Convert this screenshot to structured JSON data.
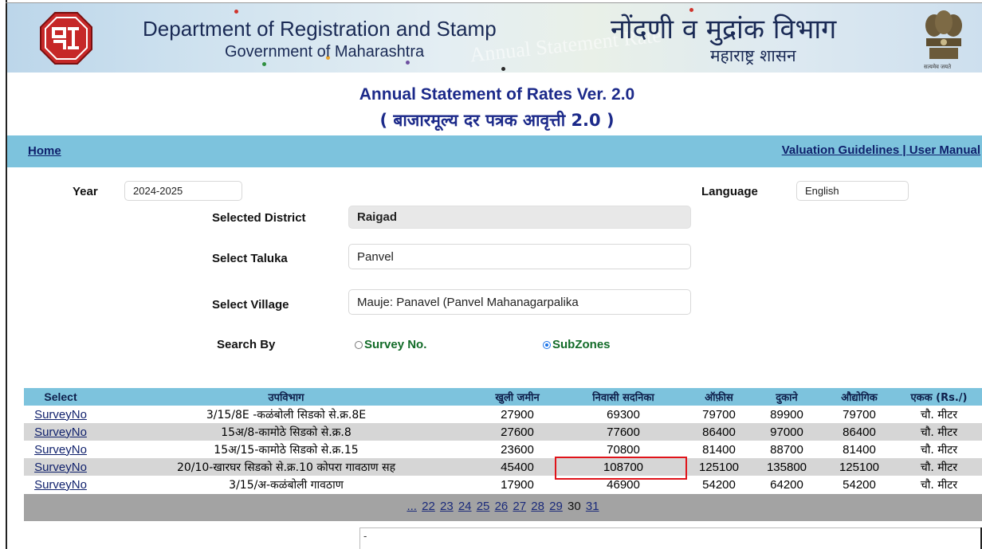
{
  "header": {
    "title_en": "Department of Registration and Stamp",
    "subtitle_en": "Government of Maharashtra",
    "title_mr": "नोंदणी व मुद्रांक विभाग",
    "subtitle_mr": "महाराष्ट्र शासन",
    "watermark": "Annual Statement Rate",
    "emblem_caption": "सत्यमेव जयते"
  },
  "page": {
    "title": "Annual Statement of Rates Ver. 2.0",
    "title_mr": "( बाजारमूल्य दर पत्रक आवृत्ती 2.0 )"
  },
  "nav": {
    "home": "Home",
    "valuation": "Valuation Guidelines",
    "separator": " | ",
    "manual": "User Manual"
  },
  "form": {
    "year_label": "Year",
    "year_value": "2024-2025",
    "language_label": "Language",
    "language_value": "English",
    "district_label": "Selected District",
    "district_value": "Raigad",
    "taluka_label": "Select Taluka",
    "taluka_value": "Panvel",
    "village_label": "Select Village",
    "village_value": "Mauje: Panavel (Panvel Mahanagarpalika",
    "search_label": "Search By",
    "option_survey": "Survey No.",
    "option_subzones": "SubZones",
    "selected_option": "SubZones"
  },
  "table": {
    "headers": [
      "Select",
      "उपविभाग",
      "खुली जमीन",
      "निवासी सदनिका",
      "ऑफ़ीस",
      "दुकाने",
      "औद्योगिक",
      "एकक (Rs./)"
    ],
    "rows": [
      [
        "SurveyNo",
        "3/15/8E -कळंबोली सिडको से.क्र.8E",
        "27900",
        "69300",
        "79700",
        "89900",
        "79700",
        "चौ. मीटर"
      ],
      [
        "SurveyNo",
        "15अ/8-कामोठे सिडको से.क्र.8",
        "27600",
        "77600",
        "86400",
        "97000",
        "86400",
        "चौ. मीटर"
      ],
      [
        "SurveyNo",
        "15अ/15-कामोठे सिडको से.क्र.15",
        "23600",
        "70800",
        "81400",
        "88700",
        "81400",
        "चौ. मीटर"
      ],
      [
        "SurveyNo",
        "20/10-खारघर सिडको से.क्र.10 कोपरा गावठाण सह",
        "45400",
        "108700",
        "125100",
        "135800",
        "125100",
        "चौ. मीटर"
      ],
      [
        "SurveyNo",
        "3/15/अ-कळंबोली गावठाण",
        "17900",
        "46900",
        "54200",
        "64200",
        "54200",
        "चौ. मीटर"
      ]
    ],
    "pager": {
      "ellipsis": "...",
      "pages": [
        "22",
        "23",
        "24",
        "25",
        "26",
        "27",
        "28",
        "29",
        "30",
        "31"
      ],
      "current": "30"
    }
  },
  "bottom_box_text": "-"
}
